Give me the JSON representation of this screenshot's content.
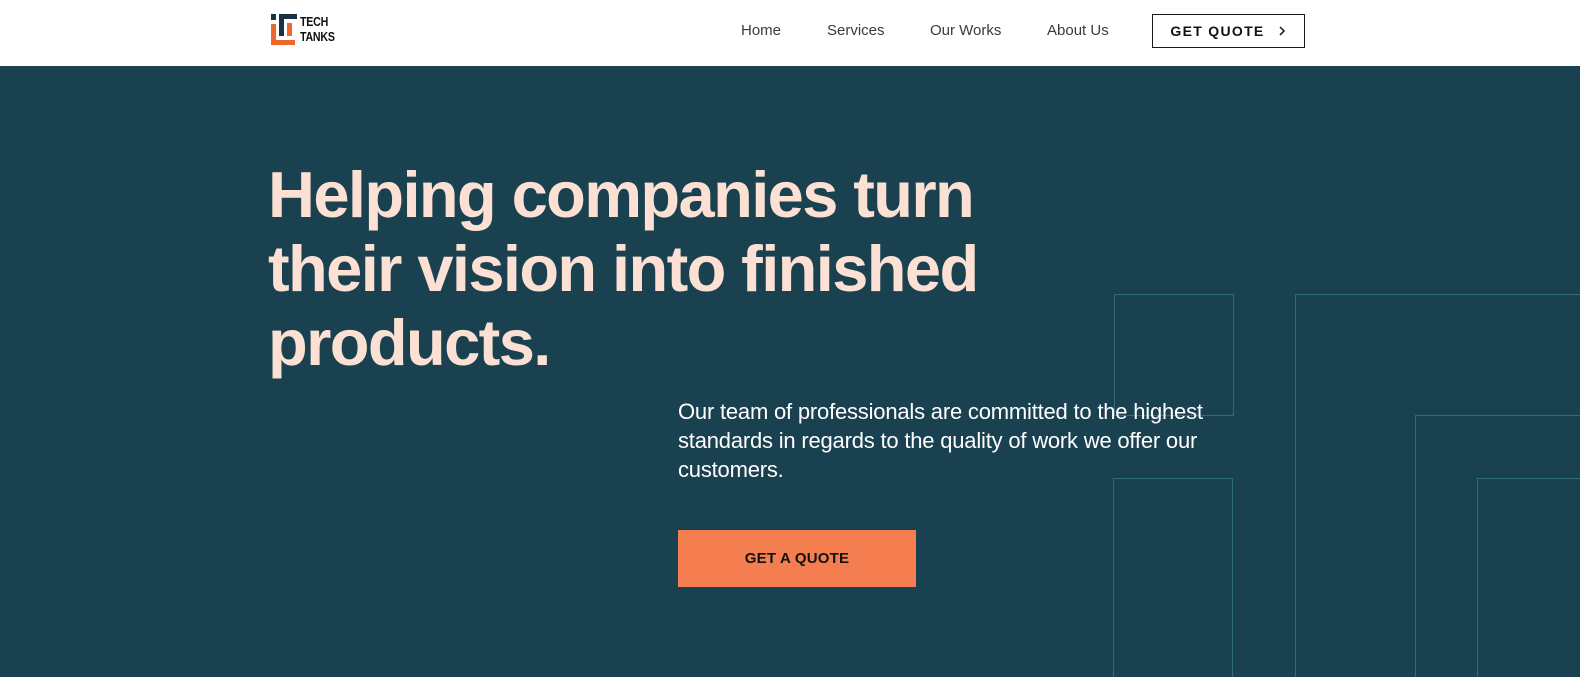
{
  "brand": {
    "logo_line1": "TECH",
    "logo_line2": "TANKS",
    "logo_colors": {
      "dark": "#1b3140",
      "accent": "#f0672c"
    }
  },
  "nav": {
    "items": [
      "Home",
      "Services",
      "Our Works",
      "About Us"
    ],
    "quote_button": "GET QUOTE",
    "quote_icon": "chevron-right-icon"
  },
  "hero": {
    "title": "Helping companies turn their vision into finished products.",
    "description": "Our team of professionals are committed to the highest standards in regards to the quality of work we offer our customers.",
    "cta_label": "GET A QUOTE"
  },
  "colors": {
    "hero_background": "#1a4150",
    "hero_title": "#fbe0d3",
    "cta_background": "#f47e4f",
    "decoration_lines": "#2f6b7c"
  }
}
